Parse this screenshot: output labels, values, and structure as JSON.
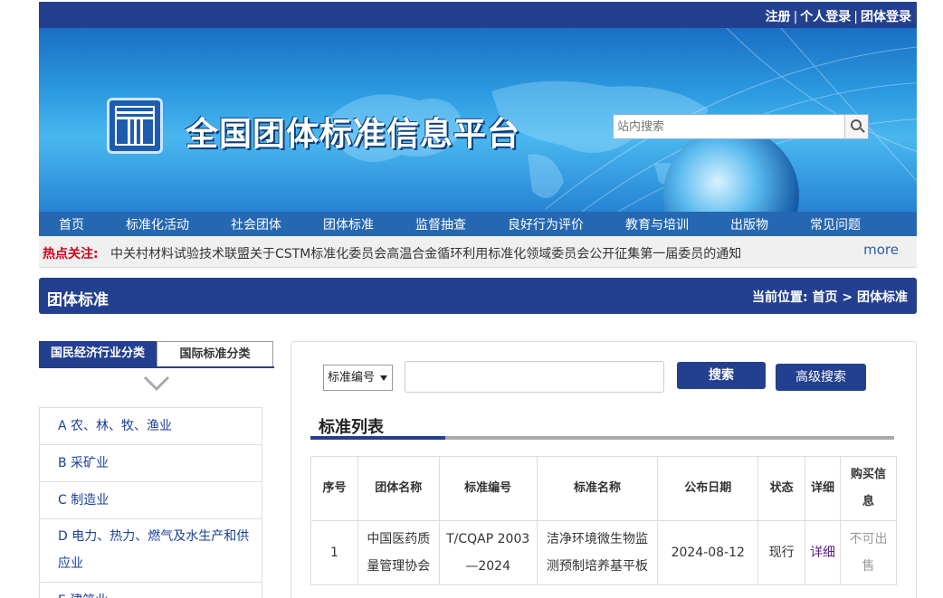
{
  "header": {
    "top_links": [
      "注册",
      "个人登录",
      "团体登录"
    ],
    "site_title": "全国团体标准信息平台",
    "search_placeholder": "站内搜索"
  },
  "nav": {
    "items": [
      "首页",
      "标准化活动",
      "社会团体",
      "团体标准",
      "监督抽查",
      "良好行为评价",
      "教育与培训",
      "出版物",
      "常见问题"
    ]
  },
  "hot": {
    "label": "热点关注:",
    "news": "中关村材料试验技术联盟关于CSTM标准化委员会高温合金循环利用标准化领域委员会公开征集第一届委员的通知",
    "more": "more"
  },
  "section": {
    "title": "团体标准",
    "breadcrumb": "当前位置: 首页 > 团体标准"
  },
  "sidebar": {
    "tabs": [
      "国民经济行业分类",
      "国际标准分类"
    ],
    "categories": [
      "A 农、林、牧、渔业",
      "B 采矿业",
      "C 制造业",
      "D 电力、热力、燃气及水生产和供应业",
      "E 建筑业"
    ]
  },
  "search": {
    "select_value": "标准编号",
    "search_label": "搜索",
    "advanced_label": "高级搜索"
  },
  "list": {
    "title": "标准列表",
    "columns": [
      "序号",
      "团体名称",
      "标准编号",
      "标准名称",
      "公布日期",
      "状态",
      "详细",
      "购买信息"
    ],
    "rows": [
      [
        "1",
        "中国医药质量管理协会",
        "T/CQAP 2003—2024",
        "洁净环境微生物监测预制培养基平板",
        "2024-08-12",
        "现行",
        "详细",
        "不可出售"
      ]
    ]
  },
  "colors": {
    "primary": "#233f8f",
    "nav": "#2568b1",
    "hot_label": "#d0021b",
    "link": "#1a3f9a"
  }
}
